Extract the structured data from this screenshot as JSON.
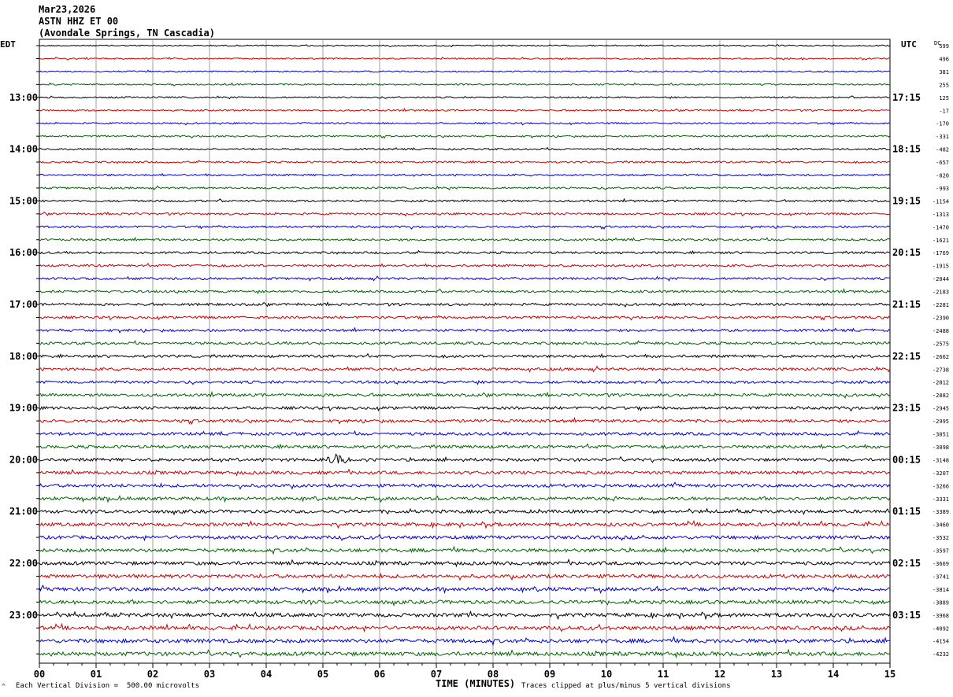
{
  "header": {
    "date": "Mar23,2026",
    "station": "ASTN HHZ ET 00",
    "location": "(Avondale Springs, TN Cascadia)"
  },
  "left_tz": "EDT",
  "right_tz": "UTC",
  "dc_label": "DC",
  "footer": {
    "scale_note": "Each Vertical Division =  500.00 microvolts",
    "xlabel": "TIME (MINUTES)",
    "clip_note": "Traces clipped at plus/minus 5 vertical divisions",
    "corner_mark": "^"
  },
  "chart_data": {
    "type": "line",
    "xlabel": "TIME (MINUTES)",
    "x_ticks": [
      "00",
      "01",
      "02",
      "03",
      "04",
      "05",
      "06",
      "07",
      "08",
      "09",
      "10",
      "11",
      "12",
      "13",
      "14",
      "15"
    ],
    "xlim": [
      0,
      15
    ],
    "trace_count": 48,
    "trace_colors": [
      "#000000",
      "#cc0000",
      "#0000cc",
      "#006600"
    ],
    "left_hour_labels": [
      {
        "trace": 4,
        "label": "13:00"
      },
      {
        "trace": 8,
        "label": "14:00"
      },
      {
        "trace": 12,
        "label": "15:00"
      },
      {
        "trace": 16,
        "label": "16:00"
      },
      {
        "trace": 20,
        "label": "17:00"
      },
      {
        "trace": 24,
        "label": "18:00"
      },
      {
        "trace": 28,
        "label": "19:00"
      },
      {
        "trace": 32,
        "label": "20:00"
      },
      {
        "trace": 36,
        "label": "21:00"
      },
      {
        "trace": 40,
        "label": "22:00"
      },
      {
        "trace": 44,
        "label": "23:00"
      }
    ],
    "right_hour_labels": [
      {
        "trace": 4,
        "label": "17:15"
      },
      {
        "trace": 8,
        "label": "18:15"
      },
      {
        "trace": 12,
        "label": "19:15"
      },
      {
        "trace": 16,
        "label": "20:15"
      },
      {
        "trace": 20,
        "label": "21:15"
      },
      {
        "trace": 24,
        "label": "22:15"
      },
      {
        "trace": 28,
        "label": "23:15"
      },
      {
        "trace": 32,
        "label": "00:15"
      },
      {
        "trace": 36,
        "label": "01:15"
      },
      {
        "trace": 40,
        "label": "02:15"
      },
      {
        "trace": 44,
        "label": "03:15"
      }
    ],
    "dc_offsets": [
      "599",
      "496",
      "381",
      "255",
      "125",
      "-17",
      "-170",
      "-331",
      "-482",
      "-657",
      "-820",
      "-993",
      "-1154",
      "-1313",
      "-1470",
      "-1621",
      "-1769",
      "-1915",
      "-2044",
      "-2183",
      "-2281",
      "-2390",
      "-2488",
      "-2575",
      "-2662",
      "-2738",
      "-2812",
      "-2882",
      "-2945",
      "-2995",
      "-3051",
      "-3098",
      "-3148",
      "-3207",
      "-3266",
      "-3331",
      "-3389",
      "-3460",
      "-3532",
      "-3597",
      "-3669",
      "-3741",
      "-3814",
      "-3889",
      "-3968",
      "-4092",
      "-4154",
      "-4232"
    ],
    "events": [
      {
        "trace": 32,
        "start_min": 5.0,
        "end_min": 6.0,
        "peak_min": 5.25,
        "label": ""
      }
    ]
  }
}
